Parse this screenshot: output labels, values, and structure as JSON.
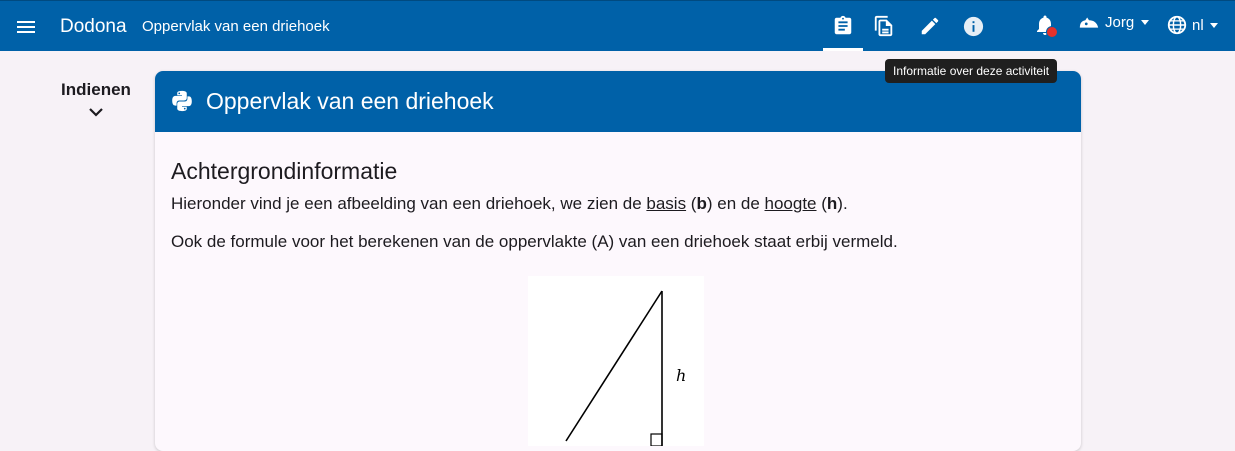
{
  "navbar": {
    "brand": "Dodona",
    "breadcrumb": "Oppervlak van een driehoek",
    "tabs": [
      {
        "name": "description",
        "icon": "clipboard-icon",
        "active": true
      },
      {
        "name": "submissions",
        "icon": "documents-icon",
        "active": false
      },
      {
        "name": "edit",
        "icon": "pencil-icon",
        "active": false
      },
      {
        "name": "info",
        "icon": "info-icon",
        "active": false
      }
    ],
    "user": "Jorg",
    "language": "nl",
    "notification_dot_color": "#e5312a"
  },
  "tooltip": {
    "text": "Informatie over deze activiteit"
  },
  "left_panel": {
    "label": "Indienen"
  },
  "card": {
    "title": "Oppervlak van een driehoek",
    "heading": "Achtergrondinformatie",
    "p1": {
      "before": "Hieronder vind je een afbeelding van een driehoek, we zien de ",
      "link_basis": "basis",
      "paren1_open": " (",
      "b": "b",
      "middle": ") en de ",
      "link_hoogte": "hoogte",
      "paren2_open": " (",
      "h": "h",
      "end": ")."
    },
    "p2": "Ook de formule voor het berekenen van de oppervlakte (A) van een driehoek staat erbij vermeld.",
    "figure_label_h": "h"
  },
  "colors": {
    "primary": "#0061a8",
    "background": "#f7f2f7",
    "card": "#fdf8fd"
  }
}
